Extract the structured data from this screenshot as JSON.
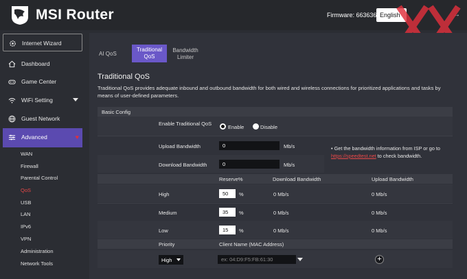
{
  "header": {
    "brand": "MSI Router",
    "firmware": "Firmware: 663636",
    "language": "English",
    "logout_glyph": "→"
  },
  "sidebar": {
    "items": [
      {
        "label": "Internet Wizard",
        "icon": "gear-icon"
      },
      {
        "label": "Dashboard",
        "icon": "home-icon"
      },
      {
        "label": "Game Center",
        "icon": "gamepad-icon"
      },
      {
        "label": "WiFi Setting",
        "icon": "wifi-icon"
      },
      {
        "label": "Guest Network",
        "icon": "globe-icon"
      },
      {
        "label": "Advanced",
        "icon": "sliders-icon"
      }
    ],
    "sub_items": [
      "WAN",
      "Firewall",
      "Parental Control",
      "QoS",
      "USB",
      "LAN",
      "IPv6",
      "VPN",
      "Administration",
      "Network Tools"
    ],
    "active_sub": "QoS",
    "colors": {
      "active_bg": "#5b4ab0",
      "active_sub": "#e84848"
    }
  },
  "tabs": [
    "AI QoS",
    "Traditional QoS",
    "Bandwidth Limiter"
  ],
  "main": {
    "title": "Traditional QoS",
    "description": "Traditional QoS provides adequate inbound and outbound bandwidth for both wired and wireless connections for prioritized applications and tasks by means of user-defined parameters.",
    "basic_config": "Basic Config",
    "enable_label": "Enable Traditional QoS",
    "enable_option": "Enable",
    "disable_option": "Disable",
    "upload_label": "Upload Bandwidth",
    "upload_value": "0",
    "download_label": "Download Bandwidth",
    "download_value": "0",
    "unit_mbps": "Mb/s",
    "note_bullet": "•",
    "note_text": "Get the bandwidth information from ISP or go to",
    "note_link": "https://speedtest.net",
    "note_tail": "to check bandwidth.",
    "table_headers": [
      "Reserve%",
      "Download Bandwidth",
      "Upload Bandwidth"
    ],
    "rows": [
      {
        "name": "High",
        "reserve": "50",
        "download": "0 Mb/s",
        "upload": "0 Mb/s"
      },
      {
        "name": "Medium",
        "reserve": "35",
        "download": "0 Mb/s",
        "upload": "0 Mb/s"
      },
      {
        "name": "Low",
        "reserve": "15",
        "download": "0 Mb/s",
        "upload": "0 Mb/s"
      }
    ],
    "percent": "%",
    "priority_header": "Priority",
    "client_header": "Client Name (MAC Address)",
    "priority_value": "High",
    "client_placeholder": "ex: 04:D9:F5:FB:61:30",
    "add_glyph": "+"
  },
  "watermark": {
    "icon": "xx-watermark-icon",
    "color": "#e0303c"
  }
}
